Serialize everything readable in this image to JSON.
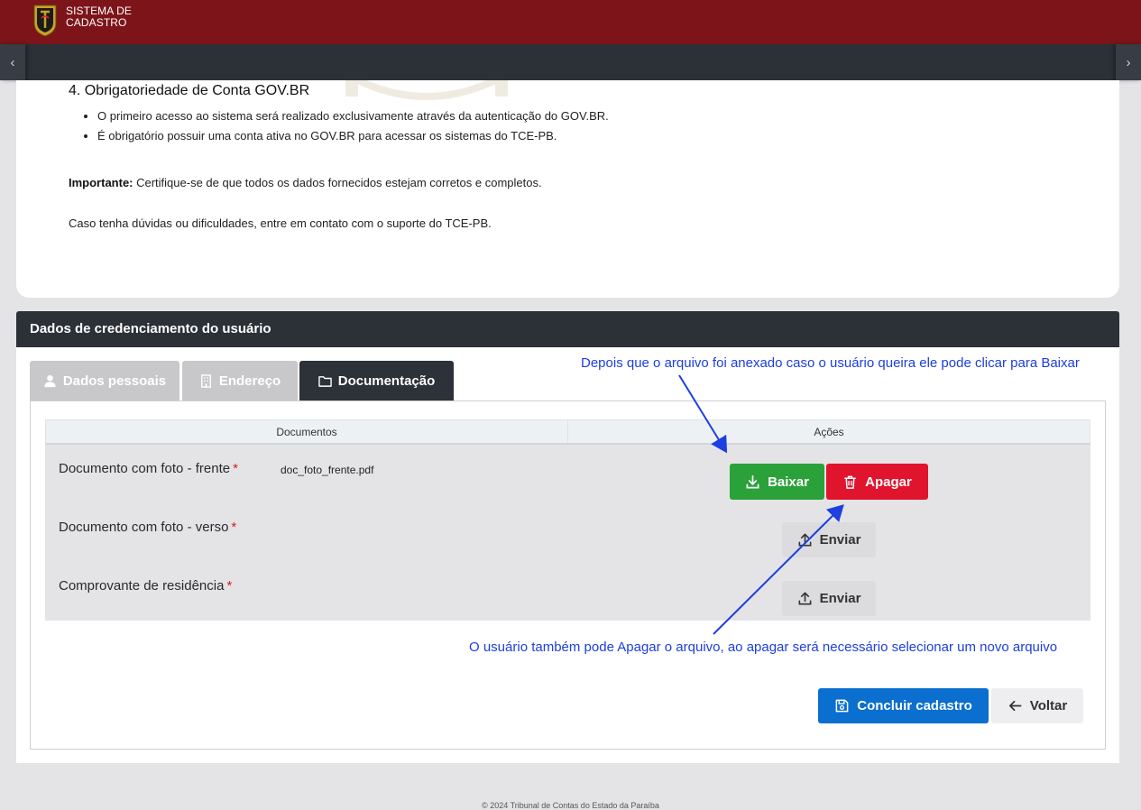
{
  "header": {
    "brand_line1": "SISTEMA DE",
    "brand_line2": "CADASTRO"
  },
  "colors": {
    "primary_bar": "#7d141a",
    "dark_bar": "#2c3037",
    "success": "#2ba13a",
    "danger": "#e0142d",
    "primary_button": "#0a6fcf",
    "annotation": "#1d3ee0"
  },
  "info": {
    "title": "4. Obrigatoriedade de Conta GOV.BR",
    "bullets": [
      "O primeiro acesso ao sistema será realizado exclusivamente através da autenticação do GOV.BR.",
      "É obrigatório possuir uma conta ativa no GOV.BR para acessar os sistemas do TCE-PB."
    ],
    "important_label": "Importante:",
    "important_text": " Certifique-se de que todos os dados fornecidos estejam corretos e completos.",
    "contact": "Caso tenha dúvidas ou dificuldades, entre em contato com o suporte do TCE-PB."
  },
  "credenciamento": {
    "title": "Dados de credenciamento do usuário",
    "tabs": [
      {
        "label": "Dados pessoais",
        "icon": "user-icon",
        "active": false
      },
      {
        "label": "Endereço",
        "icon": "building-icon",
        "active": false
      },
      {
        "label": "Documentação",
        "icon": "folder-icon",
        "active": true
      }
    ],
    "table": {
      "headers": [
        "Documentos",
        "Ações"
      ],
      "rows": [
        {
          "name": "Documento com foto - frente",
          "required_mark": "*",
          "file": "doc_foto_frente.pdf"
        },
        {
          "name": "Documento com foto - verso",
          "required_mark": "*",
          "file": ""
        },
        {
          "name": "Comprovante de residência",
          "required_mark": "*",
          "file": ""
        }
      ]
    },
    "buttons": {
      "baixar": "Baixar",
      "apagar": "Apagar",
      "enviar": "Enviar",
      "concluir": "Concluir cadastro",
      "voltar": "Voltar"
    }
  },
  "annotations": {
    "top": "Depois que o arquivo foi anexado caso o usuário queira ele pode clicar para Baixar",
    "bottom": "O usuário também pode Apagar o arquivo, ao apagar será necessário selecionar um novo arquivo"
  },
  "footer": "© 2024 Tribunal de Contas do Estado da Paraíba"
}
